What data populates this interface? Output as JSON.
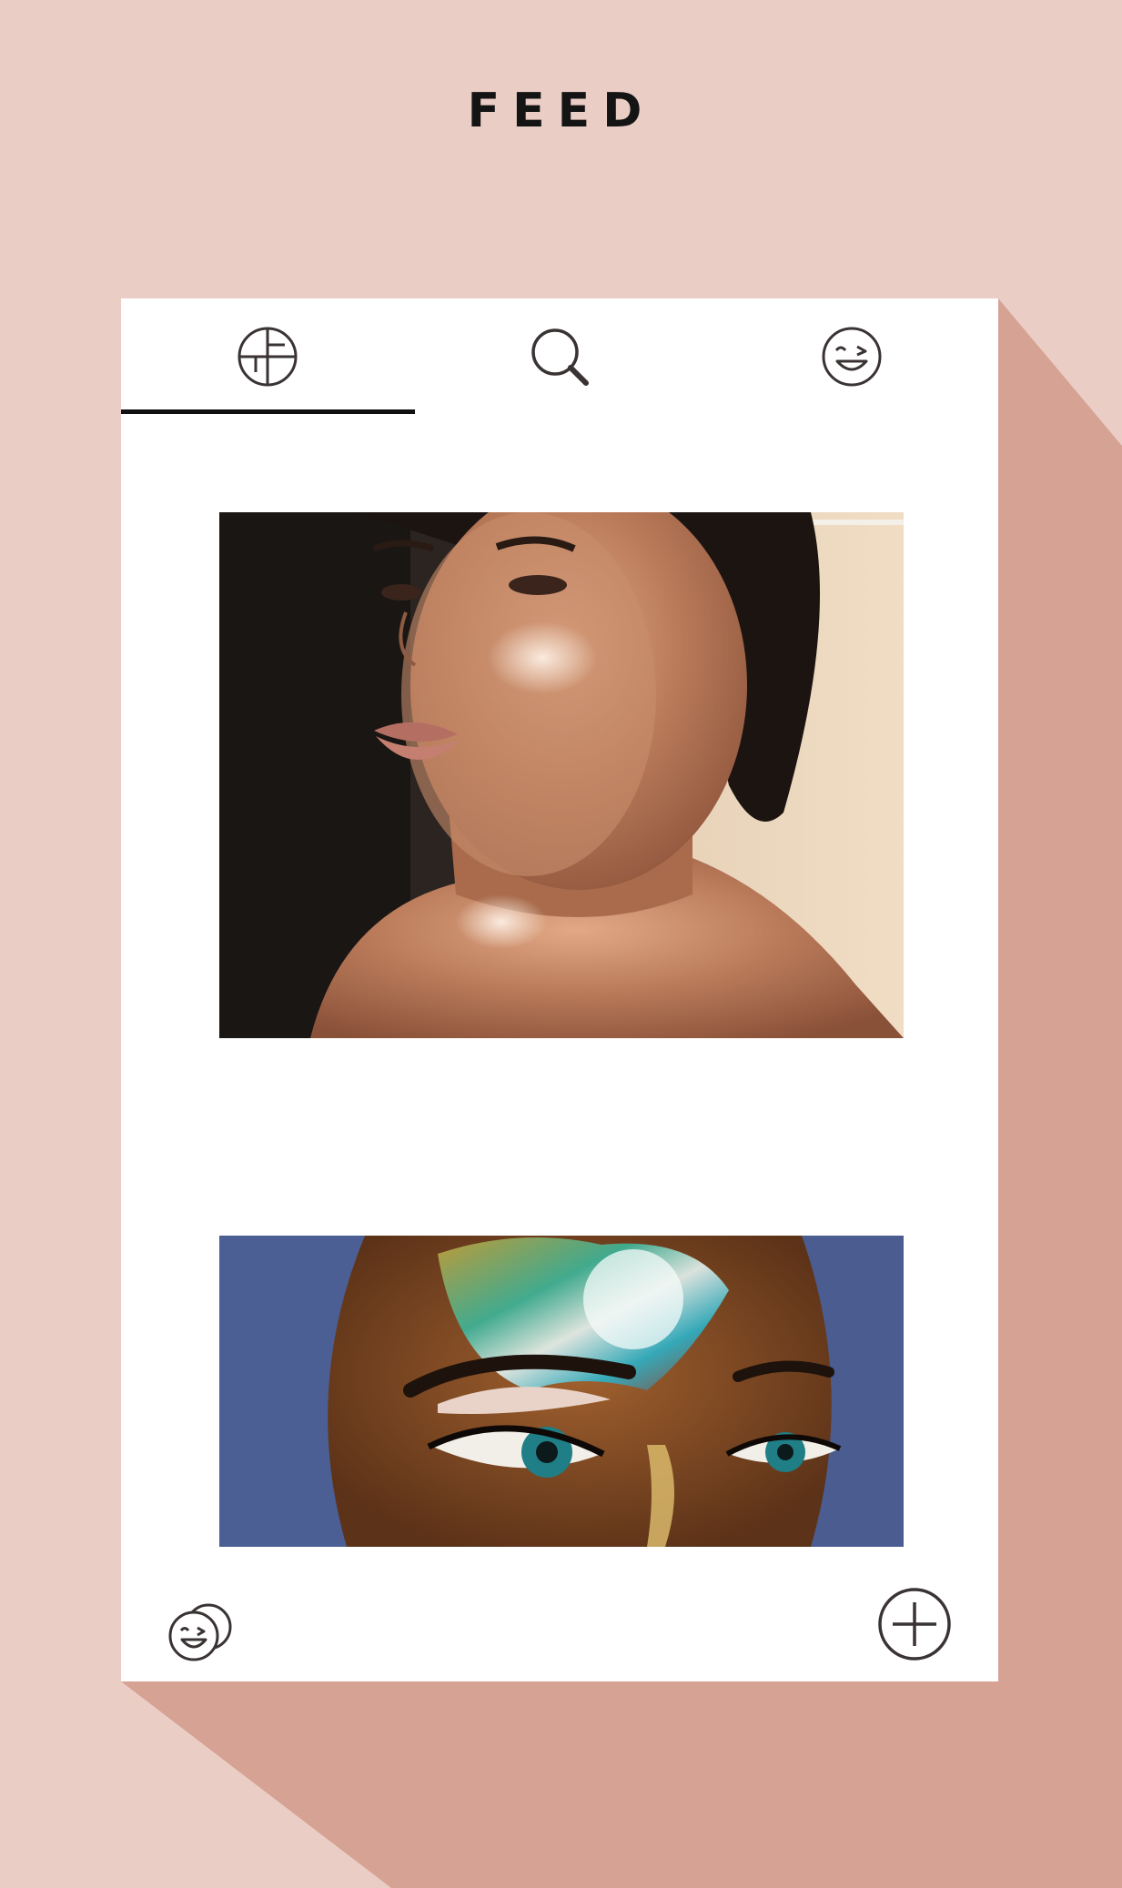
{
  "header": {
    "title": "FEED"
  },
  "tabs": [
    {
      "icon": "feed-grid-icon",
      "active": true
    },
    {
      "icon": "search-icon",
      "active": false
    },
    {
      "icon": "wink-face-icon",
      "active": false
    }
  ],
  "feed": {
    "posts": [
      {
        "image": "glowing-highlighter-portrait-photo"
      },
      {
        "image": "holographic-eye-makeup-photo"
      }
    ]
  },
  "footer": {
    "left_icon": "profile-faces-icon",
    "right_icon": "add-post-icon"
  },
  "colors": {
    "background": "#eacdc4",
    "shadow": "#d6a294",
    "card": "#ffffff",
    "icon_stroke": "#3a3333",
    "tab_indicator": "#111111"
  }
}
